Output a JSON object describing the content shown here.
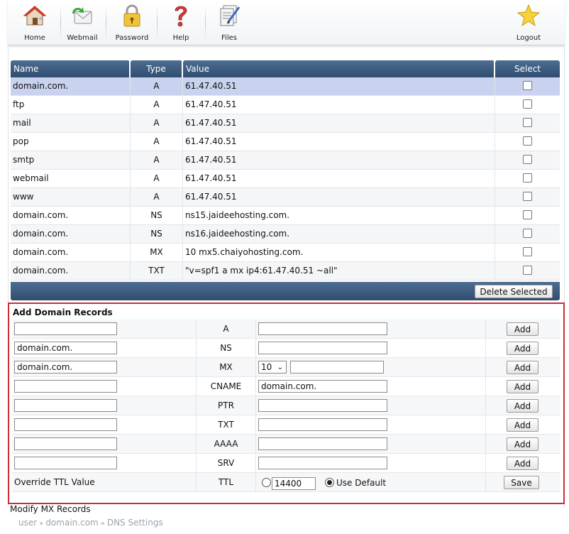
{
  "toolbar": {
    "items": [
      {
        "label": "Home",
        "icon": "house-icon"
      },
      {
        "label": "Webmail",
        "icon": "mail-icon"
      },
      {
        "label": "Password",
        "icon": "lock-icon"
      },
      {
        "label": "Help",
        "icon": "question-icon"
      },
      {
        "label": "Files",
        "icon": "files-icon"
      }
    ],
    "logout": {
      "label": "Logout",
      "icon": "star-icon"
    }
  },
  "records": {
    "headers": {
      "name": "Name",
      "type": "Type",
      "value": "Value",
      "select": "Select"
    },
    "rows": [
      {
        "name": "domain.com.",
        "type": "A",
        "value": "61.47.40.51"
      },
      {
        "name": "ftp",
        "type": "A",
        "value": "61.47.40.51"
      },
      {
        "name": "mail",
        "type": "A",
        "value": "61.47.40.51"
      },
      {
        "name": "pop",
        "type": "A",
        "value": "61.47.40.51"
      },
      {
        "name": "smtp",
        "type": "A",
        "value": "61.47.40.51"
      },
      {
        "name": "webmail",
        "type": "A",
        "value": "61.47.40.51"
      },
      {
        "name": "www",
        "type": "A",
        "value": "61.47.40.51"
      },
      {
        "name": "domain.com.",
        "type": "NS",
        "value": "ns15.jaideehosting.com."
      },
      {
        "name": "domain.com.",
        "type": "NS",
        "value": "ns16.jaideehosting.com."
      },
      {
        "name": "domain.com.",
        "type": "MX",
        "value": "10 mx5.chaiyohosting.com."
      },
      {
        "name": "domain.com.",
        "type": "TXT",
        "value": "\"v=spf1 a mx ip4:61.47.40.51 ~all\""
      }
    ],
    "delete_label": "Delete Selected"
  },
  "add": {
    "title": "Add Domain Records",
    "add_label": "Add",
    "rows": [
      {
        "type": "A",
        "name": "",
        "value": ""
      },
      {
        "type": "NS",
        "name": "domain.com.",
        "value": ""
      },
      {
        "type": "MX",
        "name": "domain.com.",
        "priority": "10",
        "value": ""
      },
      {
        "type": "CNAME",
        "name": "",
        "value": "domain.com."
      },
      {
        "type": "PTR",
        "name": "",
        "value": ""
      },
      {
        "type": "TXT",
        "name": "",
        "value": ""
      },
      {
        "type": "AAAA",
        "name": "",
        "value": ""
      },
      {
        "type": "SRV",
        "name": "",
        "value": ""
      }
    ],
    "ttl": {
      "label": "Override TTL Value",
      "type": "TTL",
      "value": "14400",
      "default_label": "Use Default",
      "save_label": "Save"
    }
  },
  "links": {
    "modify_mx": "Modify MX Records"
  },
  "breadcrumb": [
    "user",
    "domain.com",
    "DNS Settings"
  ]
}
